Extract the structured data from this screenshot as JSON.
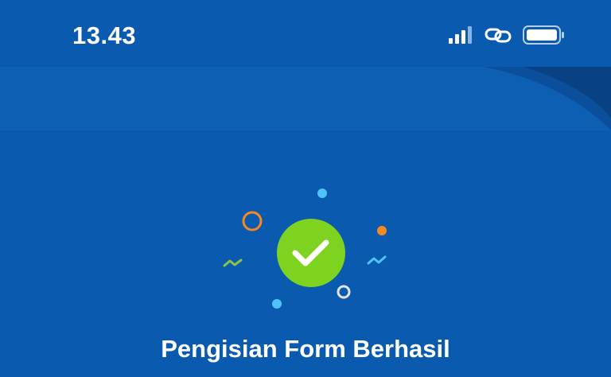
{
  "status_bar": {
    "time": "13.43",
    "icons": [
      "signal-icon",
      "link-icon",
      "battery-icon"
    ]
  },
  "result": {
    "title": "Pengisian Form Berhasil",
    "icon": "check-icon"
  },
  "colors": {
    "background": "#0a5ab0",
    "header_band": "#0d5fb4",
    "success_green": "#7ed321",
    "accent_orange": "#f5891f",
    "accent_light_blue": "#4fc3f7",
    "accent_lime": "#8bc34a"
  }
}
